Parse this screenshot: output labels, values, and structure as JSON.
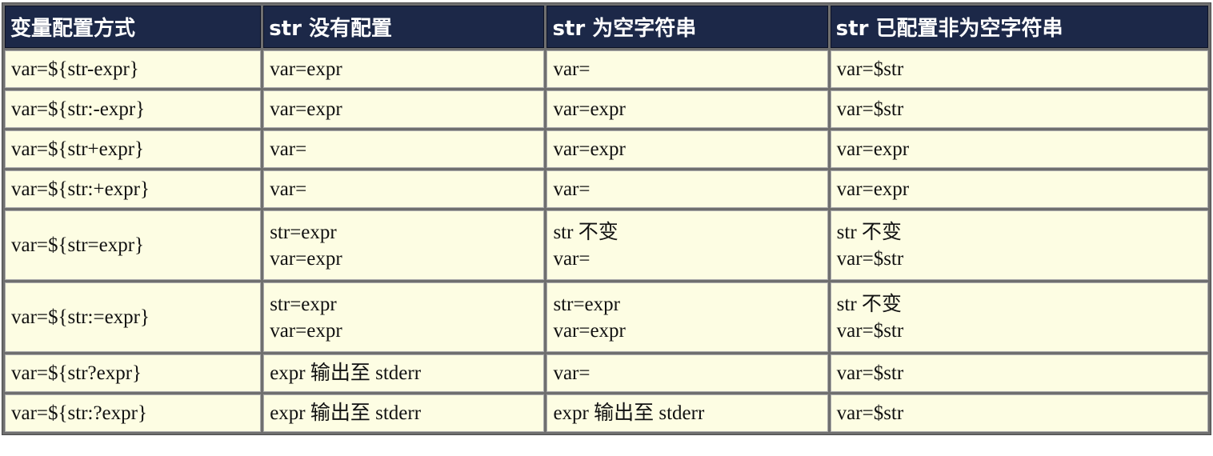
{
  "headers": [
    "变量配置方式",
    "str 没有配置",
    "str 为空字符串",
    "str 已配置非为空字符串"
  ],
  "rows": [
    {
      "method": "var=${str-expr}",
      "not_set": [
        "var=expr"
      ],
      "empty": [
        "var="
      ],
      "set_nonempty": [
        "var=$str"
      ]
    },
    {
      "method": "var=${str:-expr}",
      "not_set": [
        "var=expr"
      ],
      "empty": [
        "var=expr"
      ],
      "set_nonempty": [
        "var=$str"
      ]
    },
    {
      "method": "var=${str+expr}",
      "not_set": [
        "var="
      ],
      "empty": [
        "var=expr"
      ],
      "set_nonempty": [
        "var=expr"
      ]
    },
    {
      "method": "var=${str:+expr}",
      "not_set": [
        "var="
      ],
      "empty": [
        "var="
      ],
      "set_nonempty": [
        "var=expr"
      ]
    },
    {
      "method": "var=${str=expr}",
      "not_set": [
        "str=expr",
        "var=expr"
      ],
      "empty": [
        "str 不变",
        "var="
      ],
      "set_nonempty": [
        "str 不变",
        "var=$str"
      ]
    },
    {
      "method": "var=${str:=expr}",
      "not_set": [
        "str=expr",
        "var=expr"
      ],
      "empty": [
        "str=expr",
        "var=expr"
      ],
      "set_nonempty": [
        "str 不变",
        "var=$str"
      ]
    },
    {
      "method": "var=${str?expr}",
      "not_set": [
        "expr 输出至 stderr"
      ],
      "empty": [
        "var="
      ],
      "set_nonempty": [
        "var=$str"
      ]
    },
    {
      "method": "var=${str:?expr}",
      "not_set": [
        "expr 输出至 stderr"
      ],
      "empty": [
        "expr 输出至 stderr"
      ],
      "set_nonempty": [
        "var=$str"
      ]
    }
  ]
}
